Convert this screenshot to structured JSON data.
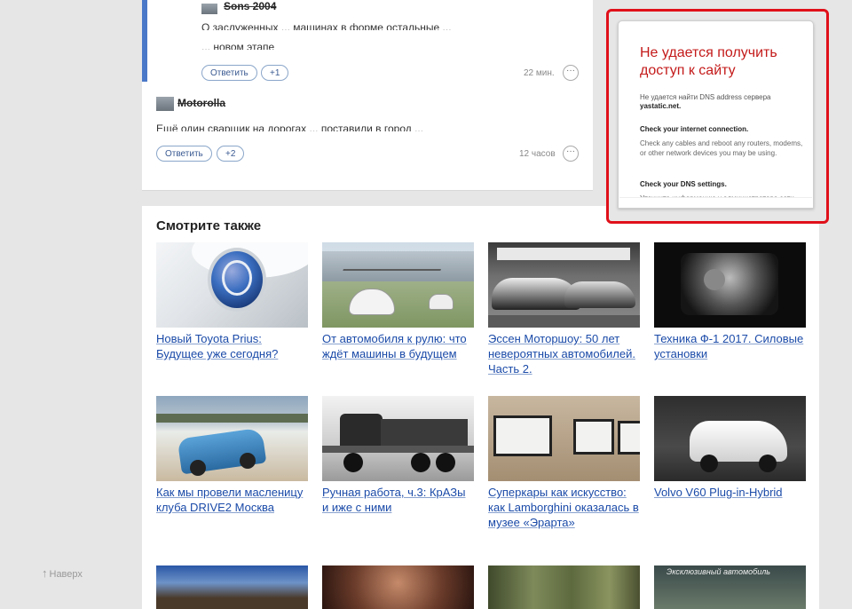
{
  "comments": [
    {
      "author": "Sons 2004",
      "text_line1": "О заслуженных ... машинах в форме остальные ...",
      "text_line2": "... новом этапе",
      "reply_label": "Ответить",
      "plus_label": "+1",
      "time": "22 мин.",
      "more_label": "···"
    },
    {
      "author": "Motorolla",
      "text_line1": "Ещё один сварщик на дорогах ... поставили в город ...",
      "reply_label": "Ответить",
      "plus_label": "+2",
      "time": "12 часов",
      "more_label": "···"
    }
  ],
  "see_also": {
    "title": "Смотрите также",
    "items": [
      {
        "title": "Новый Toyota Prius: Будущее уже сегодня?"
      },
      {
        "title": "От автомобиля к рулю: что ждёт машины в будущем"
      },
      {
        "title": "Эссен Моторшоу: 50 лет невероятных автомобилей. Часть 2."
      },
      {
        "title": "Техника Ф-1 2017. Силовые установки"
      },
      {
        "title": "Как мы провели масленицу клуба DRIVE2 Москва"
      },
      {
        "title": "Ручная работа, ч.3: КрАЗы и иже с ними"
      },
      {
        "title": "Суперкары как искусство: как Lamborghini оказалась в музее «Эрарта»"
      },
      {
        "title": "Volvo V60 Plug-in-Hybrid"
      }
    ],
    "row3_caption": "Эксклюзивный автомобиль"
  },
  "error": {
    "title": "Не удается получить доступ к сайту",
    "desc_line1": "Не удается найти DNS address сервера",
    "desc_host": "yastatic.net.",
    "check_internet": "Check your internet connection.",
    "check_internet_desc": "Check any cables and reboot any routers, modems, or other network devices you may be using.",
    "check_dns": "Check your DNS settings.",
    "check_dns_desc": "Уточните информацию у администратора сети."
  },
  "scroll_up": "Наверх",
  "colors": {
    "link": "#1a4aa8",
    "error_red": "#c41a1a",
    "highlight_border": "#e0101a",
    "accent": "#4a78c8"
  }
}
